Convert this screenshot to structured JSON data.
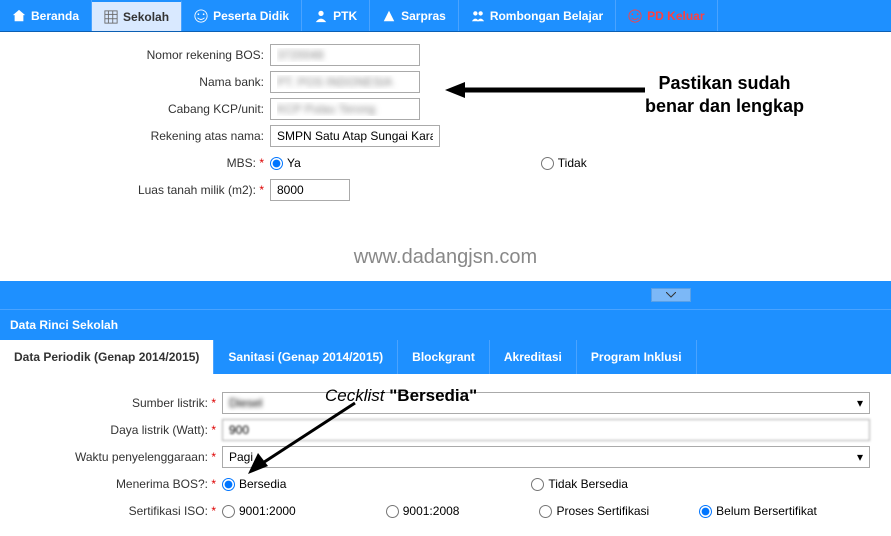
{
  "topnav": {
    "items": [
      {
        "label": "Beranda",
        "icon": "home-icon"
      },
      {
        "label": "Sekolah",
        "icon": "grid-icon"
      },
      {
        "label": "Peserta Didik",
        "icon": "smile-icon"
      },
      {
        "label": "PTK",
        "icon": "user-icon"
      },
      {
        "label": "Sarpras",
        "icon": "building-icon"
      },
      {
        "label": "Rombongan Belajar",
        "icon": "group-icon"
      },
      {
        "label": "PD Keluar",
        "icon": "smile-icon"
      }
    ]
  },
  "form1": {
    "nomor_rekening_label": "Nomor rekening BOS:",
    "nomor_rekening_value": "3720048",
    "nama_bank_label": "Nama bank:",
    "nama_bank_value": "PT. POS INDONESIA",
    "cabang_label": "Cabang KCP/unit:",
    "cabang_value": "KCP Pulau Terong",
    "rekening_nama_label": "Rekening atas nama:",
    "rekening_nama_value": "SMPN Satu Atap Sungai Karang",
    "mbs_label": "MBS:",
    "mbs_ya": "Ya",
    "mbs_tidak": "Tidak",
    "luas_label": "Luas tanah milik (m2):",
    "luas_value": "8000"
  },
  "watermark": "www.dadangjsn.com",
  "section_header": "Data Rinci Sekolah",
  "subnav": {
    "items": [
      {
        "label": "Data Periodik (Genap 2014/2015)"
      },
      {
        "label": "Sanitasi (Genap 2014/2015)"
      },
      {
        "label": "Blockgrant"
      },
      {
        "label": "Akreditasi"
      },
      {
        "label": "Program Inklusi"
      }
    ]
  },
  "form2": {
    "sumber_listrik_label": "Sumber listrik:",
    "sumber_listrik_value": "Diesel",
    "daya_label": "Daya listrik (Watt):",
    "daya_value": "900",
    "waktu_label": "Waktu penyelenggaraan:",
    "waktu_value": "Pagi",
    "menerima_bos_label": "Menerima BOS?:",
    "bos_bersedia": "Bersedia",
    "bos_tidak": "Tidak Bersedia",
    "iso_label": "Sertifikasi ISO:",
    "iso_9001_2000": "9001:2000",
    "iso_9001_2008": "9001:2008",
    "iso_proses": "Proses Sertifikasi",
    "iso_belum": "Belum Bersertifikat"
  },
  "annotations": {
    "annot1_line1": "Pastikan sudah",
    "annot1_line2": "benar dan lengkap",
    "annot2_prefix": "Cecklist ",
    "annot2_quote": "\"Bersedia\""
  }
}
